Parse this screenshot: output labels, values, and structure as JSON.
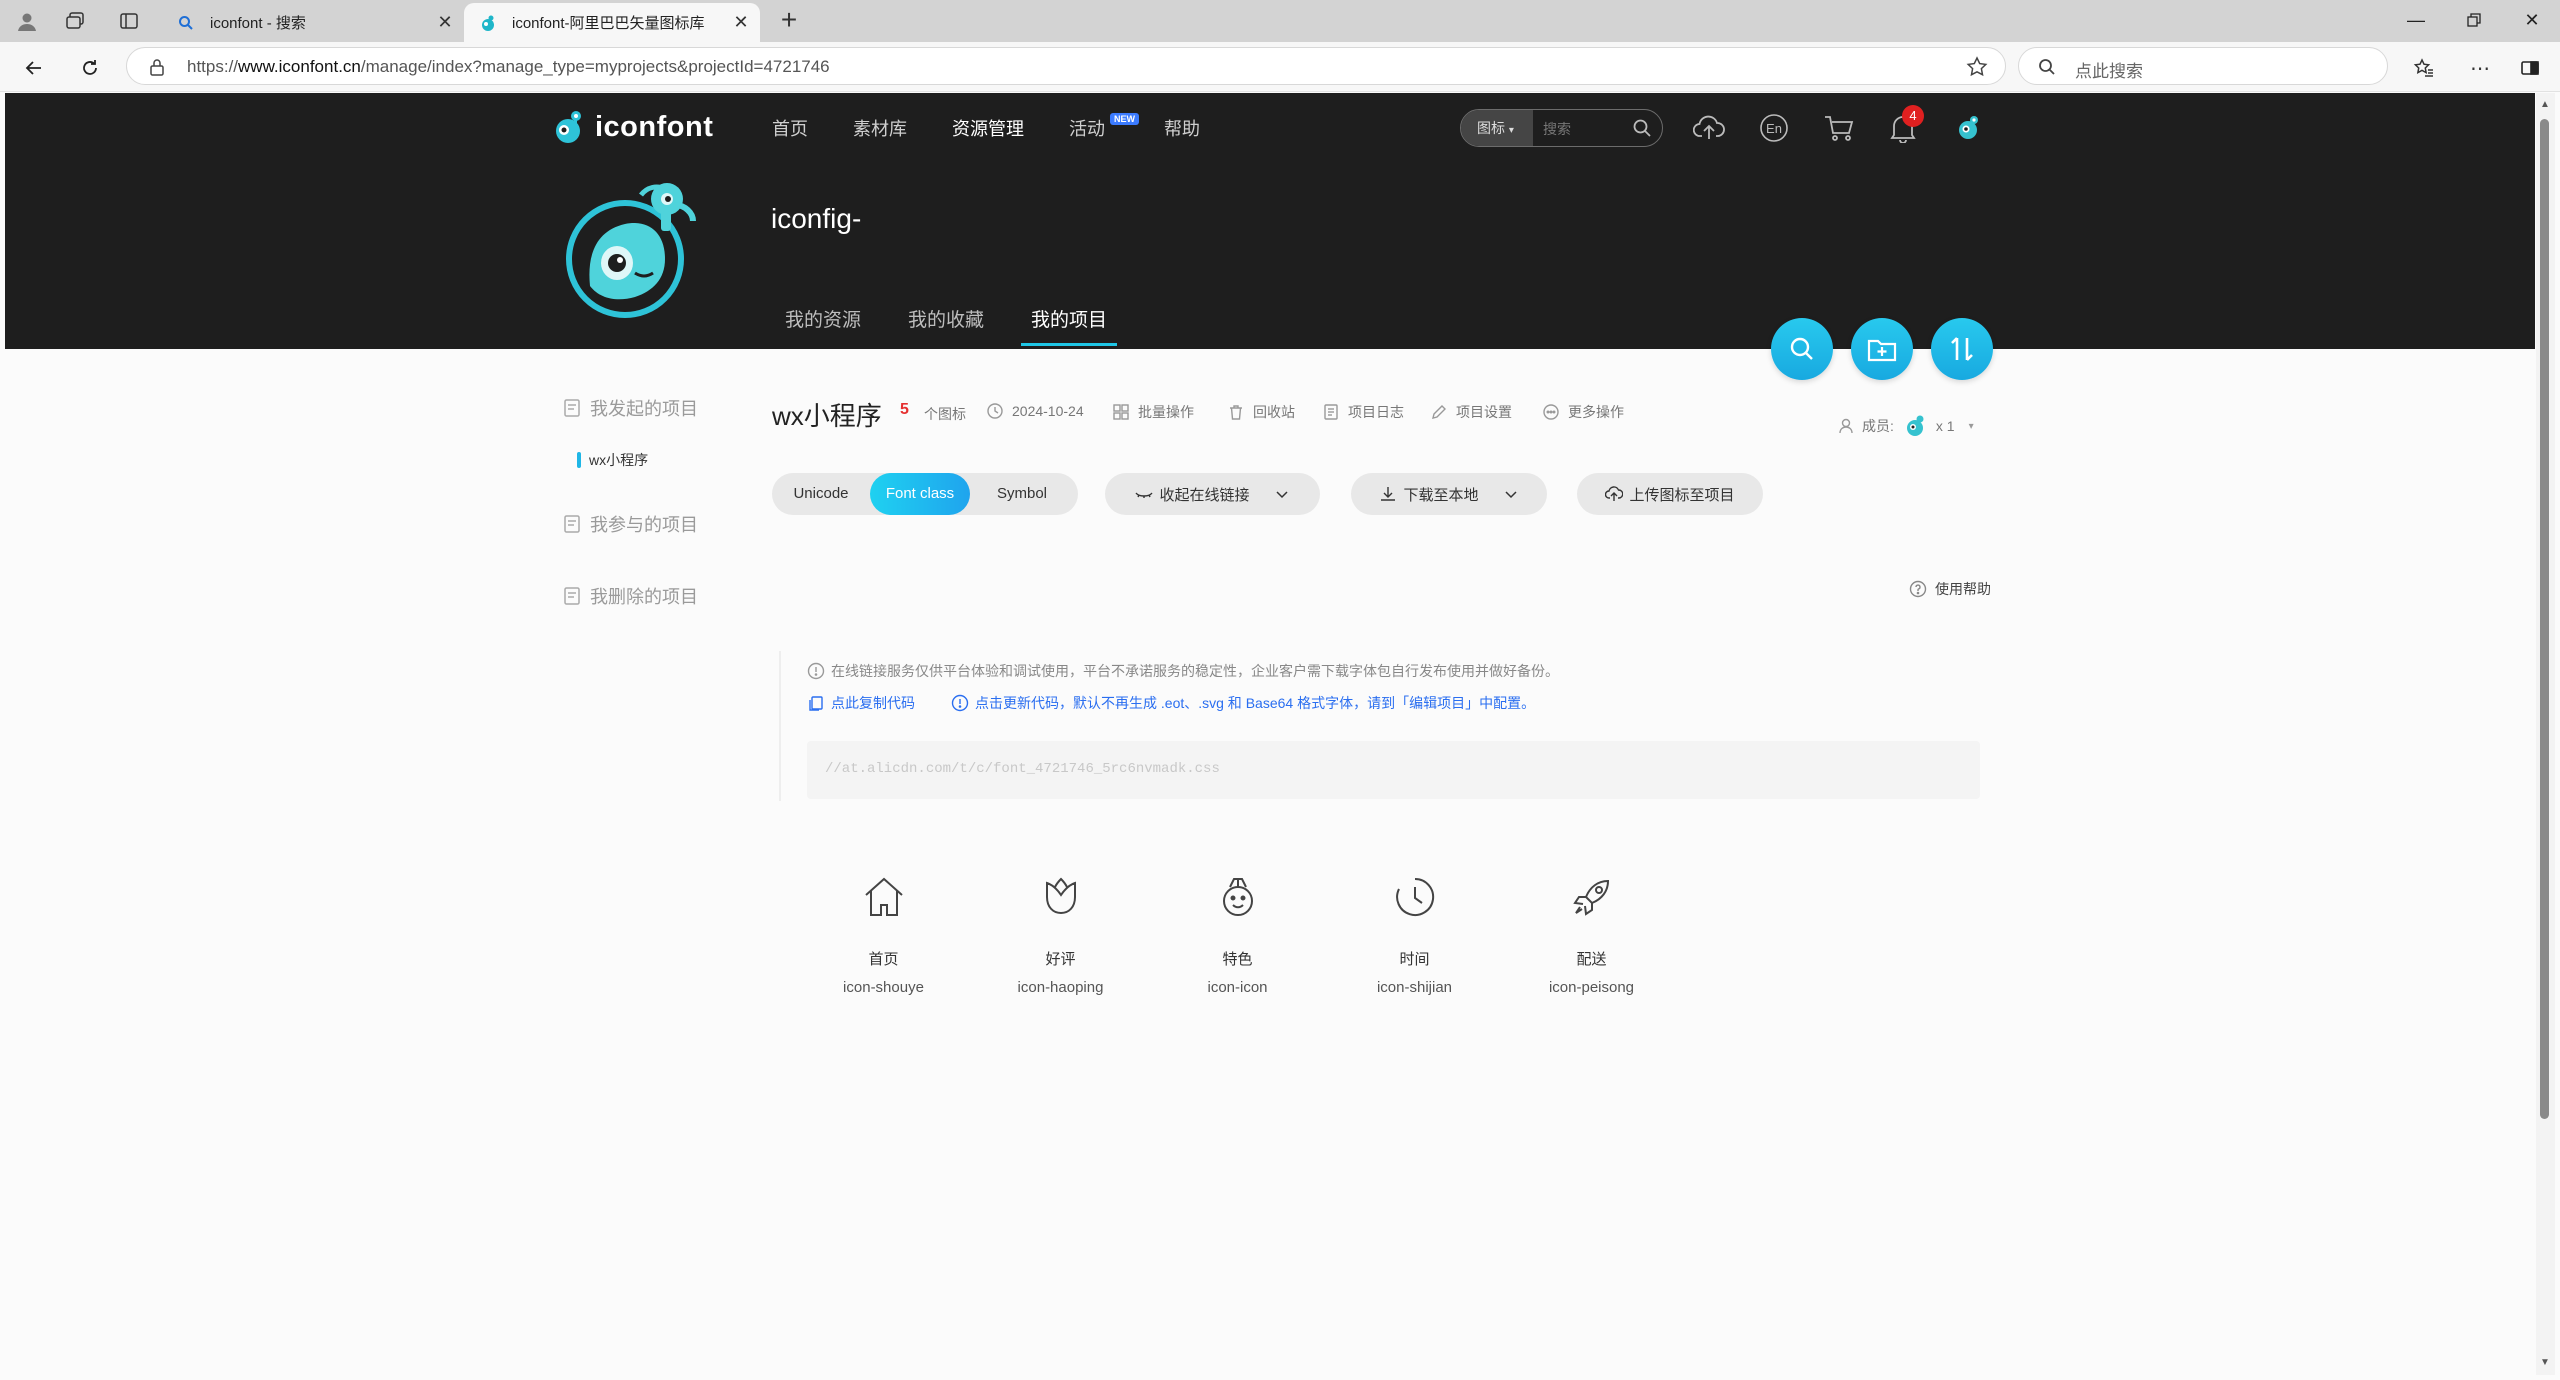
{
  "browser": {
    "tabs": [
      {
        "title": "iconfont - 搜索",
        "active": false
      },
      {
        "title": "iconfont-阿里巴巴矢量图标库",
        "active": true
      }
    ],
    "url_prefix": "https://",
    "url_host": "www.iconfont.cn",
    "url_path": "/manage/index?manage_type=myprojects&projectId=4721746",
    "search_placeholder": "点此搜索"
  },
  "header": {
    "logo_text": "iconfont",
    "nav": [
      {
        "label": "首页",
        "active": false
      },
      {
        "label": "素材库",
        "active": false
      },
      {
        "label": "资源管理",
        "active": true
      },
      {
        "label": "活动",
        "active": false,
        "badge": "NEW"
      },
      {
        "label": "帮助",
        "active": false
      }
    ],
    "search_type": "图标",
    "search_placeholder": "搜索",
    "notification_count": "4"
  },
  "profile": {
    "name": "iconfig-",
    "tabs": [
      {
        "label": "我的资源",
        "active": false
      },
      {
        "label": "我的收藏",
        "active": false
      },
      {
        "label": "我的项目",
        "active": true
      }
    ]
  },
  "sidebar": {
    "sections": [
      {
        "label": "我发起的项目"
      },
      {
        "label": "我参与的项目"
      },
      {
        "label": "我删除的项目"
      }
    ],
    "active_project": "wx小程序"
  },
  "project": {
    "title": "wx小程序",
    "icon_count": "5",
    "icon_count_label": "个图标",
    "date": "2024-10-24",
    "actions": [
      "批量操作",
      "回收站",
      "项目日志",
      "项目设置",
      "更多操作"
    ],
    "members_label": "成员:",
    "members_count": "x 1"
  },
  "toolbar": {
    "formats": [
      {
        "label": "Unicode",
        "active": false
      },
      {
        "label": "Font class",
        "active": true
      },
      {
        "label": "Symbol",
        "active": false
      }
    ],
    "collapse_link": "收起在线链接",
    "download": "下载至本地",
    "upload": "上传图标至项目",
    "help": "使用帮助"
  },
  "notice": {
    "warning": "在线链接服务仅供平台体验和调试使用，平台不承诺服务的稳定性，企业客户需下载字体包自行发布使用并做好备份。",
    "copy_code": "点此复制代码",
    "update_code": "点击更新代码，默认不再生成 .eot、.svg 和 Base64 格式字体，请到「编辑项目」中配置。",
    "code": "//at.alicdn.com/t/c/font_4721746_5rc6nvmadk.css"
  },
  "icons": [
    {
      "name": "首页",
      "code": "icon-shouye",
      "glyph": "home-icon"
    },
    {
      "name": "好评",
      "code": "icon-haoping",
      "glyph": "flower-icon"
    },
    {
      "name": "特色",
      "code": "icon-icon",
      "glyph": "medal-icon"
    },
    {
      "name": "时间",
      "code": "icon-shijian",
      "glyph": "clock-icon"
    },
    {
      "name": "配送",
      "code": "icon-peisong",
      "glyph": "rocket-icon"
    }
  ]
}
